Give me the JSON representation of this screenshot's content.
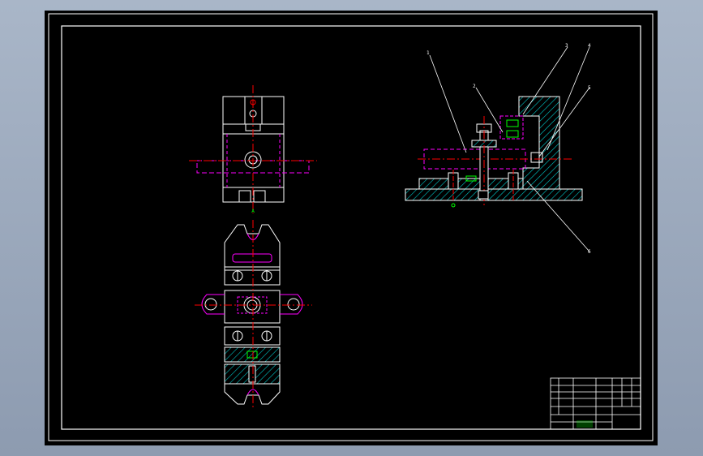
{
  "drawing": {
    "title": "",
    "colors": {
      "frame": "#ffffff",
      "outline": "#ffffff",
      "centerline": "#ff00ff",
      "hatch": "#00c8c8",
      "hidden": "#ff00ff",
      "dimension": "#00ff00",
      "leader": "#ffffff",
      "accent": "#ff0000"
    }
  },
  "views": {
    "front": {
      "label": "front-view"
    },
    "top": {
      "label": "top-view",
      "note": "A"
    },
    "section": {
      "label": "section-view"
    }
  },
  "balloons": [
    {
      "text": "1"
    },
    {
      "text": "2"
    },
    {
      "text": "3"
    },
    {
      "text": "4"
    },
    {
      "text": "5"
    },
    {
      "text": "6"
    }
  ],
  "title_block": {
    "cells": [
      "",
      "",
      "",
      "",
      "",
      "",
      "",
      ""
    ]
  }
}
